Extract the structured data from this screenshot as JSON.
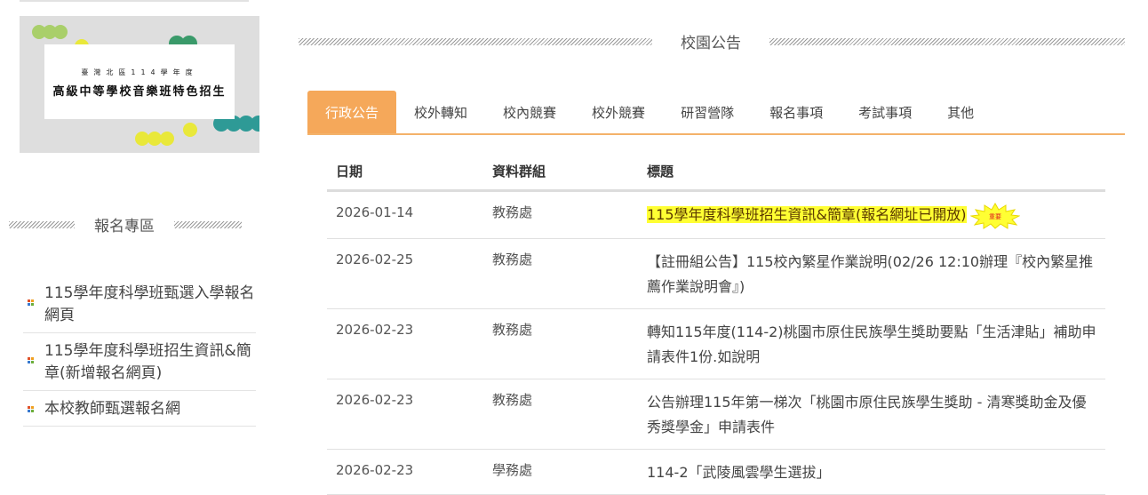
{
  "banner": {
    "subtitle": "臺灣北區114學年度",
    "title": "高級中等學校音樂班特色招生"
  },
  "left_section": {
    "heading": "報名專區",
    "items": [
      {
        "label": "115學年度科學班甄選入學報名網頁"
      },
      {
        "label": "115學年度科學班招生資訊&簡章(新增報名網頁)"
      },
      {
        "label": "本校教師甄選報名網"
      }
    ]
  },
  "main_section": {
    "heading": "校園公告",
    "tabs": [
      {
        "label": "行政公告",
        "active": true
      },
      {
        "label": "校外轉知"
      },
      {
        "label": "校內競賽"
      },
      {
        "label": "校外競賽"
      },
      {
        "label": "研習營隊"
      },
      {
        "label": "報名事項"
      },
      {
        "label": "考試事項"
      },
      {
        "label": "其他"
      }
    ],
    "table": {
      "headers": {
        "date": "日期",
        "group": "資料群組",
        "title": "標題"
      },
      "rows": [
        {
          "date": "2026-01-14",
          "group": "教務處",
          "title": "115學年度科學班招生資訊&簡章(報名網址已開放)",
          "highlighted": true,
          "badge": "重要"
        },
        {
          "date": "2026-02-25",
          "group": "教務處",
          "title": "【註冊組公告】115校內繁星作業說明(02/26 12:10辦理『校內繁星推薦作業說明會』)"
        },
        {
          "date": "2026-02-23",
          "group": "教務處",
          "title": "轉知115年度(114-2)桃園市原住民族學生獎助要點「生活津貼」補助申請表件1份.如說明"
        },
        {
          "date": "2026-02-23",
          "group": "教務處",
          "title": "公告辦理115年第一梯次「桃園市原住民族學生獎助 - 清寒獎助金及優秀獎學金」申請表件"
        },
        {
          "date": "2026-02-23",
          "group": "學務處",
          "title": "114-2「武陵風雲學生選拔」"
        }
      ]
    }
  },
  "colors": {
    "accent": "#f5a85a",
    "highlight": "#ffff33",
    "badge_red": "#e02020"
  }
}
